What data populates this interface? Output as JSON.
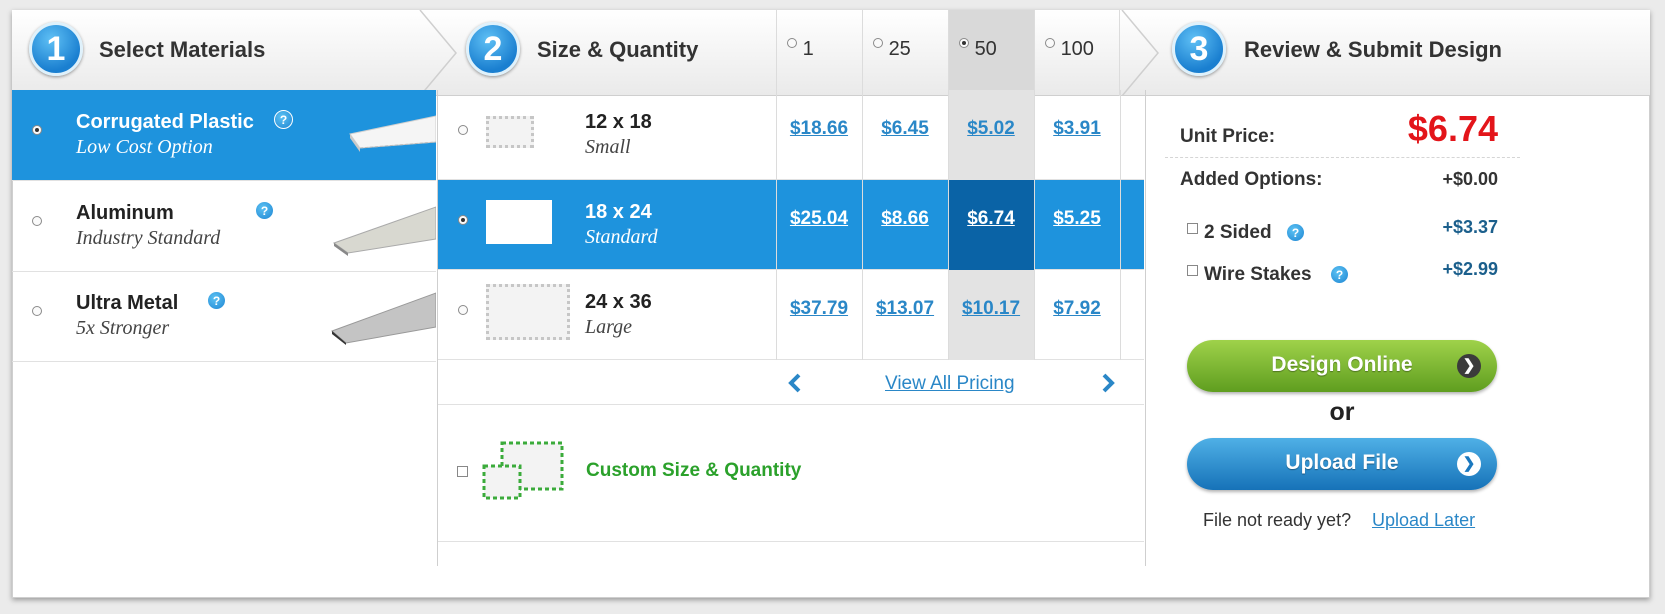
{
  "steps": [
    {
      "number": "1",
      "title": "Select Materials"
    },
    {
      "number": "2",
      "title": "Size & Quantity"
    },
    {
      "number": "3",
      "title": "Review & Submit Design"
    }
  ],
  "quantities": [
    "1",
    "25",
    "50",
    "100"
  ],
  "selected_quantity": "50",
  "materials": [
    {
      "name": "Corrugated Plastic",
      "subtitle": "Low Cost Option",
      "help": "?",
      "selected": true
    },
    {
      "name": "Aluminum",
      "subtitle": "Industry Standard",
      "help": "?",
      "selected": false
    },
    {
      "name": "Ultra Metal",
      "subtitle": "5x Stronger",
      "help": "?",
      "selected": false
    }
  ],
  "sizes": [
    {
      "size": "12 x 18",
      "label": "Small",
      "prices": [
        "$18.66",
        "$6.45",
        "$5.02",
        "$3.91"
      ],
      "selected": false
    },
    {
      "size": "18 x 24",
      "label": "Standard",
      "prices": [
        "$25.04",
        "$8.66",
        "$6.74",
        "$5.25"
      ],
      "selected": true
    },
    {
      "size": "24 x 36",
      "label": "Large",
      "prices": [
        "$37.79",
        "$13.07",
        "$10.17",
        "$7.92"
      ],
      "selected": false
    }
  ],
  "pricing_nav": {
    "prev_icon": "chevron-left-icon",
    "link": "View All Pricing",
    "next_icon": "chevron-right-icon"
  },
  "custom": {
    "label": "Custom Size & Quantity"
  },
  "review": {
    "unit_price_label": "Unit Price:",
    "unit_price": "$6.74",
    "added_options_label": "Added Options:",
    "added_options_value": "+$0.00",
    "options": [
      {
        "label": "2 Sided",
        "value": "+$3.37",
        "help": "?"
      },
      {
        "label": "Wire Stakes",
        "value": "+$2.99",
        "help": "?"
      }
    ],
    "design_online": "Design Online",
    "or": "or",
    "upload_file": "Upload File",
    "not_ready": "File not ready yet?",
    "upload_later": "Upload Later"
  },
  "colors": {
    "accent": "#1e93dd",
    "selected_cell": "#0a63a6",
    "price_red": "#e3151a",
    "green_button": "#7cb82f",
    "blue_button": "#2a8fd0"
  }
}
